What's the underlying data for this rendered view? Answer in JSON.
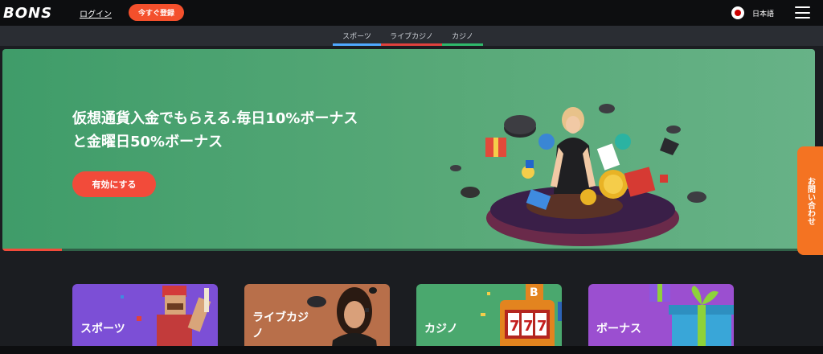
{
  "header": {
    "logo": "BONS",
    "login": "ログイン",
    "register": "今すぐ登録",
    "language": "日本語"
  },
  "subnav": {
    "tabs": [
      {
        "label": "スポーツ",
        "color": "#4fa8ff"
      },
      {
        "label": "ライブカジノ",
        "color": "#e0413d"
      },
      {
        "label": "カジノ",
        "color": "#2fb86b"
      }
    ]
  },
  "hero": {
    "title_line1": "仮想通貨入金でもらえる.毎日10%ボーナス",
    "title_line2": "と金曜日50%ボーナス",
    "button": "有効にする",
    "slide_progress": 0.073
  },
  "contact": {
    "label": "お問い合わせ"
  },
  "categories": [
    {
      "label": "スポーツ",
      "color": "#7c4fd6"
    },
    {
      "label": "ライブカジ\nノ",
      "color": "#b86f4a"
    },
    {
      "label": "カジノ",
      "color": "#4aa86e"
    },
    {
      "label": "ボーナス",
      "color": "#9b4fd0"
    }
  ],
  "colors": {
    "accent": "#f4502c",
    "hero_green": "#58a978",
    "contact_orange": "#f47322",
    "background": "#1b1d21"
  }
}
